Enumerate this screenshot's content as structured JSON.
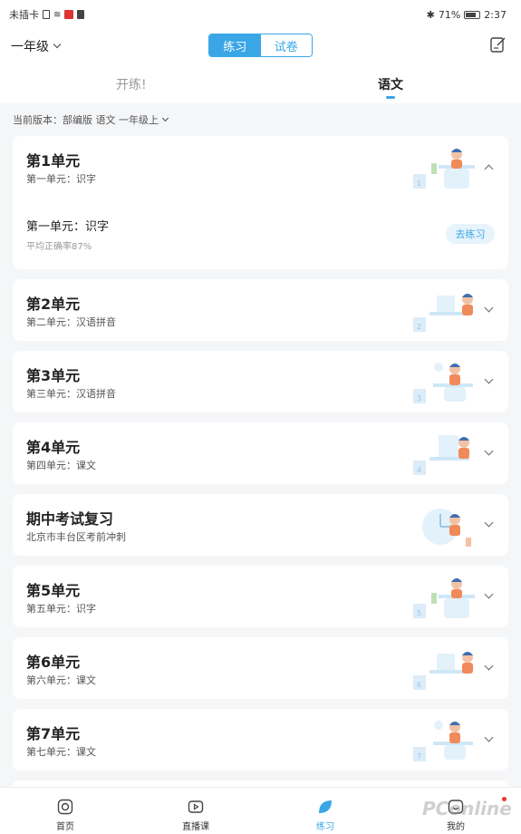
{
  "status_bar": {
    "carrier": "未插卡",
    "battery": "71%",
    "time": "2:37"
  },
  "header": {
    "grade": "一年级",
    "mode_tabs": [
      "练习",
      "试卷"
    ]
  },
  "subject_tabs": [
    "开练!",
    "语文"
  ],
  "version": "当前版本：部编版 语文 一年级上",
  "colors": {
    "accent": "#3aa6e6",
    "illustration_blue": "#cfe7f7",
    "illustration_orange": "#f08a5a"
  },
  "units": [
    {
      "title": "第1单元",
      "subtitle": "第一单元：识字",
      "expanded": true,
      "lessons": [
        {
          "title": "第一单元：识字",
          "accuracy": "平均正确率87%",
          "button": "去练习"
        }
      ]
    },
    {
      "title": "第2单元",
      "subtitle": "第二单元：汉语拼音"
    },
    {
      "title": "第3单元",
      "subtitle": "第三单元：汉语拼音"
    },
    {
      "title": "第4单元",
      "subtitle": "第四单元：课文"
    },
    {
      "title": "期中考试复习",
      "subtitle": "北京市丰台区考前冲刺"
    },
    {
      "title": "第5单元",
      "subtitle": "第五单元：识字"
    },
    {
      "title": "第6单元",
      "subtitle": "第六单元：课文"
    },
    {
      "title": "第7单元",
      "subtitle": "第七单元：课文"
    }
  ],
  "bottom_nav": [
    {
      "label": "首页",
      "icon": "home-icon"
    },
    {
      "label": "直播课",
      "icon": "live-icon"
    },
    {
      "label": "练习",
      "icon": "practice-icon"
    },
    {
      "label": "我的",
      "icon": "profile-icon"
    }
  ],
  "watermark": "PConline"
}
